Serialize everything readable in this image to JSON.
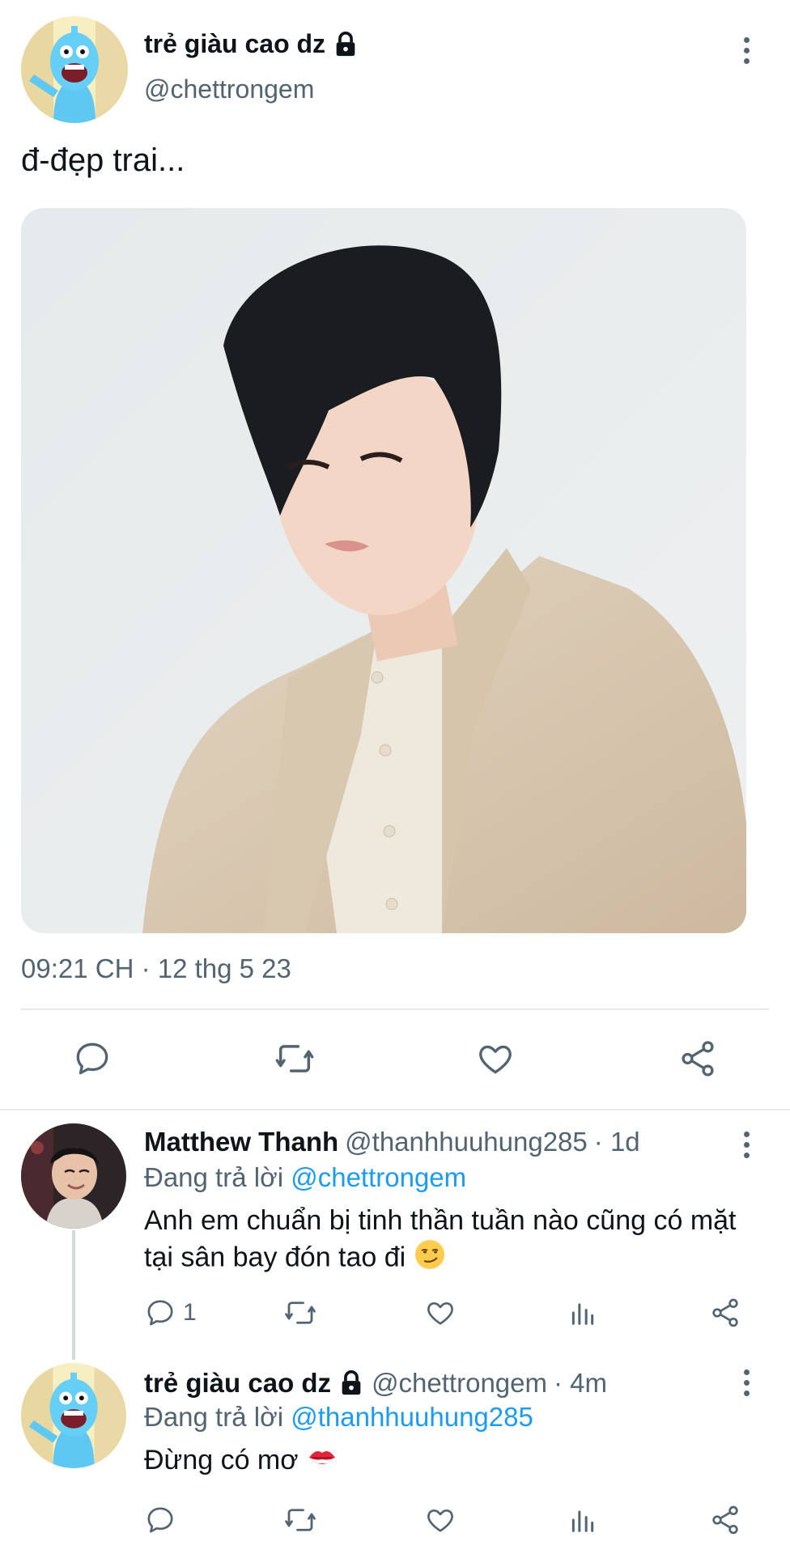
{
  "tweet": {
    "author_name": "trẻ giàu cao dz",
    "author_handle": "@chettrongem",
    "text": "đ-đẹp trai...",
    "timestamp": "09:21 CH · 12 thg 5 23",
    "icons": {
      "reply": "comment-icon",
      "retweet": "retweet-icon",
      "like": "heart-icon",
      "share": "share-icon",
      "more": "more-vertical-icon",
      "protected": "lock-icon"
    }
  },
  "replies": [
    {
      "author_name": "Matthew Thanh",
      "author_handle": "@thanhhuuhung285",
      "time": "· 1d",
      "replying_prefix": "Đang trả lời",
      "replying_to": "@chettrongem",
      "text": "Anh em chuẩn bị tinh thần tuần nào cũng có mặt tại sân bay đón tao đi",
      "text_emoji": "smirking-face",
      "reply_count": "1"
    },
    {
      "author_name": "trẻ giàu cao dz",
      "author_handle": "@chettrongem",
      "time": "· 4m",
      "replying_prefix": "Đang trả lời",
      "replying_to": "@thanhhuuhung285",
      "text": "Đừng có mơ",
      "text_emoji": "kiss-mark"
    }
  ],
  "colors": {
    "text_primary": "#0f1419",
    "text_secondary": "#536471",
    "mention": "#1d9bf0",
    "divider": "#e7e9ea"
  }
}
